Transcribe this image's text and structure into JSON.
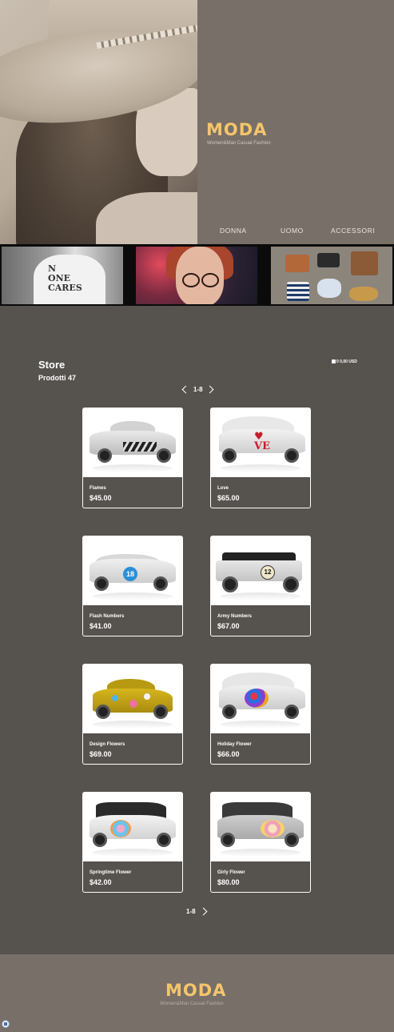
{
  "header": {
    "brand": "MODA",
    "tagline": "Women&Man Casual Fashion",
    "nav": [
      "DONNA",
      "UOMO",
      "ACCESSORI"
    ]
  },
  "thumbnails": {
    "tshirt_text": [
      "N",
      "ONE",
      "CARES"
    ]
  },
  "store": {
    "title": "Store",
    "count": "Prodotti 47",
    "cart": "0 0,00 USD",
    "pager_top": "1-8",
    "pager_bottom": "1-8"
  },
  "products": [
    {
      "name": "Flames",
      "price": "$45.00"
    },
    {
      "name": "Love",
      "price": "$65.00"
    },
    {
      "name": "Flash Numbers",
      "price": "$41.00"
    },
    {
      "name": "Army Numbers",
      "price": "$67.00"
    },
    {
      "name": "Design Flowers",
      "price": "$69.00"
    },
    {
      "name": "Holiday Flower",
      "price": "$66.00"
    },
    {
      "name": "Springtime Flower",
      "price": "$42.00"
    },
    {
      "name": "Girly Flower",
      "price": "$80.00"
    }
  ],
  "decals": {
    "love_text": "VE",
    "flash_number": "18",
    "army_number": "12"
  },
  "footer": {
    "brand": "MODA",
    "tagline": "Women&Man Casual Fashion"
  },
  "colors": {
    "brand": "#f5c56c",
    "page_bg": "#56524e",
    "header_bg": "#786f69"
  }
}
